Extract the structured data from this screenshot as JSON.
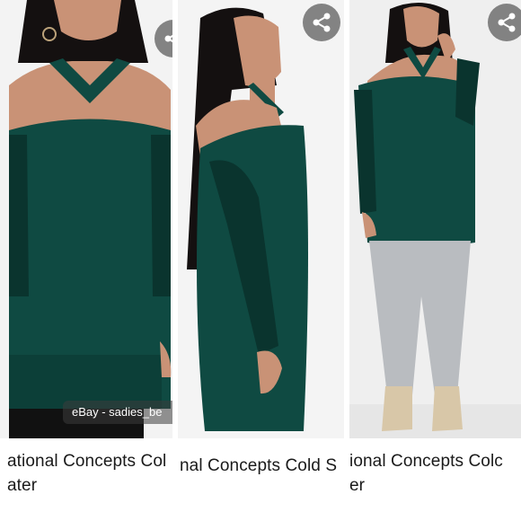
{
  "colors": {
    "sweater_green": "#0f4a42",
    "sweater_shadow": "#0a342e",
    "skin": "#c99276",
    "hair": "#141010",
    "backdrop": "#f1f1f1",
    "jeans": "#b9bcc0",
    "boots": "#d8c7a8",
    "share_button": "#6e6e6e"
  },
  "panels": [
    {
      "caption_line1": "ational Concepts Col",
      "caption_line2": "ater",
      "share_icon": "share-icon",
      "watermark": "eBay - sadies_be"
    },
    {
      "caption_line1": "nal Concepts Cold S",
      "caption_line2": "",
      "share_icon": "share-icon"
    },
    {
      "caption_line1": "ional Concepts Colc",
      "caption_line2": "er",
      "share_icon": "share-icon"
    }
  ]
}
